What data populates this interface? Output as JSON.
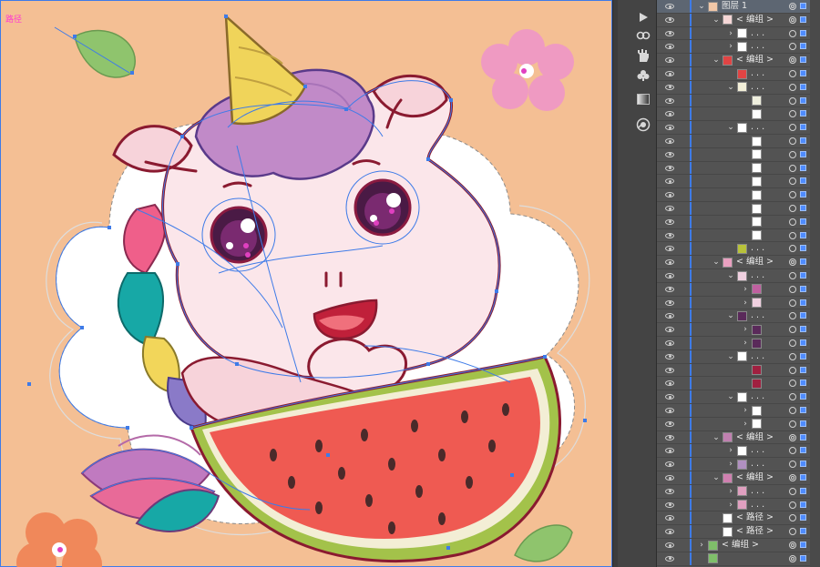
{
  "artboard": {
    "path_label": "路径",
    "bg_color": "#f4bf94",
    "accent_color": "#3e7be8"
  },
  "tools": [
    {
      "name": "play-icon",
      "glyph": "▶"
    },
    {
      "name": "link-icon",
      "glyph": "∞"
    },
    {
      "name": "puppet-warp-icon",
      "glyph": "✋"
    },
    {
      "name": "symbol-club-icon",
      "glyph": "♣"
    },
    {
      "name": "gradient-icon",
      "glyph": "▮"
    },
    {
      "name": "appearance-icon",
      "glyph": "◉"
    }
  ],
  "layers": {
    "top_layer_label": "图层 1",
    "rows": [
      {
        "indent": 0,
        "chevron": "⌄",
        "label": "图层 1",
        "thumb": "#f1c7a8",
        "kind": "layer"
      },
      {
        "indent": 1,
        "chevron": "⌄",
        "label": "< 编组 >",
        "thumb": "#f5d6d6",
        "kind": "group"
      },
      {
        "indent": 2,
        "chevron": "›",
        "label": ". . .",
        "thumb": "#ffffff",
        "kind": "item"
      },
      {
        "indent": 2,
        "chevron": "›",
        "label": ". . .",
        "thumb": "#ffffff",
        "kind": "item"
      },
      {
        "indent": 1,
        "chevron": "⌄",
        "label": "< 编组 >",
        "thumb": "#e04444",
        "kind": "group"
      },
      {
        "indent": 2,
        "chevron": "",
        "label": ". . .",
        "thumb": "#e04444",
        "kind": "item"
      },
      {
        "indent": 2,
        "chevron": "⌄",
        "label": ". . .",
        "thumb": "#f3efd8",
        "kind": "item"
      },
      {
        "indent": 3,
        "chevron": "",
        "label": "",
        "thumb": "#eeeedd",
        "kind": "item"
      },
      {
        "indent": 3,
        "chevron": "",
        "label": "",
        "thumb": "#ffffff",
        "kind": "item"
      },
      {
        "indent": 2,
        "chevron": "⌄",
        "label": ". . .",
        "thumb": "#ffffff",
        "kind": "item"
      },
      {
        "indent": 3,
        "chevron": "",
        "label": "",
        "thumb": "#ffffff",
        "kind": "item"
      },
      {
        "indent": 3,
        "chevron": "",
        "label": "",
        "thumb": "#ffffff",
        "kind": "item"
      },
      {
        "indent": 3,
        "chevron": "",
        "label": "",
        "thumb": "#ffffff",
        "kind": "item"
      },
      {
        "indent": 3,
        "chevron": "",
        "label": "",
        "thumb": "#ffffff",
        "kind": "item"
      },
      {
        "indent": 3,
        "chevron": "",
        "label": "",
        "thumb": "#ffffff",
        "kind": "item"
      },
      {
        "indent": 3,
        "chevron": "",
        "label": "",
        "thumb": "#ffffff",
        "kind": "item"
      },
      {
        "indent": 3,
        "chevron": "",
        "label": "",
        "thumb": "#ffffff",
        "kind": "item"
      },
      {
        "indent": 3,
        "chevron": "",
        "label": "",
        "thumb": "#ffffff",
        "kind": "item"
      },
      {
        "indent": 2,
        "chevron": "",
        "label": ". . .",
        "thumb": "#b8c23a",
        "kind": "item"
      },
      {
        "indent": 1,
        "chevron": "⌄",
        "label": "< 编组 >",
        "thumb": "#e9a0c0",
        "kind": "group"
      },
      {
        "indent": 2,
        "chevron": "⌄",
        "label": ". . .",
        "thumb": "#f0d0e0",
        "kind": "item"
      },
      {
        "indent": 3,
        "chevron": "›",
        "label": "",
        "thumb": "#c060a0",
        "kind": "item"
      },
      {
        "indent": 3,
        "chevron": "›",
        "label": "",
        "thumb": "#f0d0e0",
        "kind": "item"
      },
      {
        "indent": 2,
        "chevron": "⌄",
        "label": ". . .",
        "thumb": "#5a2a5a",
        "kind": "item"
      },
      {
        "indent": 3,
        "chevron": "›",
        "label": "",
        "thumb": "#5a2a5a",
        "kind": "item"
      },
      {
        "indent": 3,
        "chevron": "›",
        "label": "",
        "thumb": "#5a2a5a",
        "kind": "item"
      },
      {
        "indent": 2,
        "chevron": "⌄",
        "label": ". . .",
        "thumb": "#ffffff",
        "kind": "item"
      },
      {
        "indent": 3,
        "chevron": "",
        "label": "",
        "thumb": "#a02040",
        "kind": "item"
      },
      {
        "indent": 3,
        "chevron": "",
        "label": "",
        "thumb": "#a02040",
        "kind": "item"
      },
      {
        "indent": 2,
        "chevron": "⌄",
        "label": ". . .",
        "thumb": "#ffffff",
        "kind": "item"
      },
      {
        "indent": 3,
        "chevron": "›",
        "label": "",
        "thumb": "#ffffff",
        "kind": "item"
      },
      {
        "indent": 3,
        "chevron": "›",
        "label": "",
        "thumb": "#ffffff",
        "kind": "item"
      },
      {
        "indent": 1,
        "chevron": "⌄",
        "label": "< 编组 >",
        "thumb": "#c080b0",
        "kind": "group"
      },
      {
        "indent": 2,
        "chevron": "›",
        "label": ". . .",
        "thumb": "#ffffff",
        "kind": "item"
      },
      {
        "indent": 2,
        "chevron": "›",
        "label": ". . .",
        "thumb": "#b090c0",
        "kind": "item"
      },
      {
        "indent": 1,
        "chevron": "⌄",
        "label": "< 编组 >",
        "thumb": "#d080b0",
        "kind": "group"
      },
      {
        "indent": 2,
        "chevron": "›",
        "label": ". . .",
        "thumb": "#e0a0c0",
        "kind": "item"
      },
      {
        "indent": 2,
        "chevron": "›",
        "label": ". . .",
        "thumb": "#e0a0c0",
        "kind": "item"
      },
      {
        "indent": 1,
        "chevron": "",
        "label": "< 路径 >",
        "thumb": "#ffffff",
        "kind": "path"
      },
      {
        "indent": 1,
        "chevron": "",
        "label": "< 路径 >",
        "thumb": "#ffffff",
        "kind": "path"
      },
      {
        "indent": 0,
        "chevron": "›",
        "label": "< 编组 >",
        "thumb": "#7fbf6a",
        "kind": "group"
      },
      {
        "indent": 0,
        "chevron": "",
        "label": "",
        "thumb": "#7fbf6a",
        "kind": "group"
      }
    ]
  }
}
